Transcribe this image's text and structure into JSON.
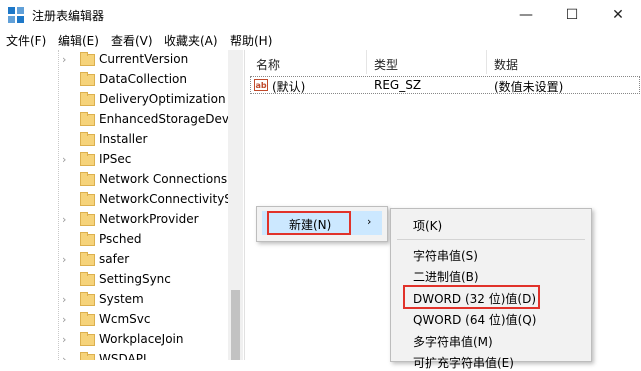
{
  "window": {
    "title": "注册表编辑器",
    "minimize": "—",
    "maximize": "☐",
    "close": "✕"
  },
  "menubar": [
    {
      "label": "文件(F)"
    },
    {
      "label": "编辑(E)"
    },
    {
      "label": "查看(V)"
    },
    {
      "label": "收藏夹(A)"
    },
    {
      "label": "帮助(H)"
    }
  ],
  "tree": {
    "items": [
      {
        "label": "CurrentVersion",
        "expandable": true
      },
      {
        "label": "DataCollection",
        "expandable": false
      },
      {
        "label": "DeliveryOptimization",
        "expandable": false
      },
      {
        "label": "EnhancedStorageDevi",
        "expandable": false
      },
      {
        "label": "Installer",
        "expandable": false
      },
      {
        "label": "IPSec",
        "expandable": true
      },
      {
        "label": "Network Connections",
        "expandable": false
      },
      {
        "label": "NetworkConnectivitySt",
        "expandable": false
      },
      {
        "label": "NetworkProvider",
        "expandable": true
      },
      {
        "label": "Psched",
        "expandable": false
      },
      {
        "label": "safer",
        "expandable": true
      },
      {
        "label": "SettingSync",
        "expandable": false
      },
      {
        "label": "System",
        "expandable": true
      },
      {
        "label": "WcmSvc",
        "expandable": true
      },
      {
        "label": "WorkplaceJoin",
        "expandable": true
      },
      {
        "label": "WSDAPI",
        "expandable": true
      }
    ]
  },
  "list": {
    "columns": [
      "名称",
      "类型",
      "数据"
    ],
    "rows": [
      {
        "icon": "ab",
        "name": "(默认)",
        "type": "REG_SZ",
        "data": "(数值未设置)"
      }
    ]
  },
  "context_menu": {
    "new_label": "新建(N)",
    "submenu_arrow": "›"
  },
  "submenu": {
    "items": [
      "项(K)",
      "字符串值(S)",
      "二进制值(B)",
      "DWORD (32 位)值(D)",
      "QWORD (64 位)值(Q)",
      "多字符串值(M)",
      "可扩充字符串值(E)"
    ]
  },
  "colors": {
    "highlight": "#cce8ff",
    "annotation_red": "#e1322a",
    "folder": "#f6d37a"
  }
}
